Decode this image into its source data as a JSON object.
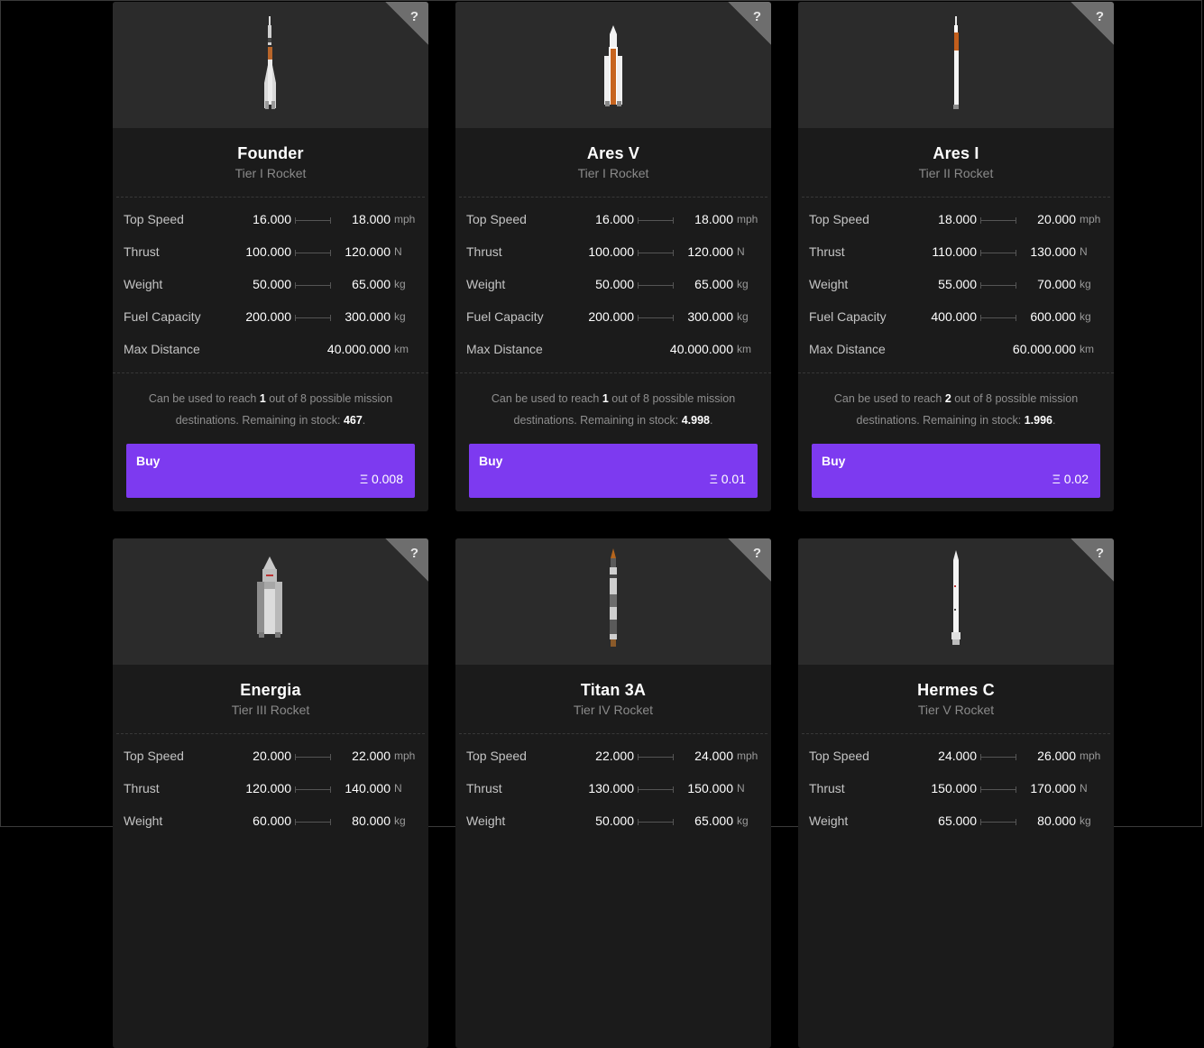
{
  "cards": [
    {
      "name": "Founder",
      "tier": "Tier I Rocket",
      "help": "?",
      "stats": {
        "top_speed": {
          "label": "Top Speed",
          "min": "16.000",
          "max": "18.000",
          "unit": "mph"
        },
        "thrust": {
          "label": "Thrust",
          "min": "100.000",
          "max": "120.000",
          "unit": "N"
        },
        "weight": {
          "label": "Weight",
          "min": "50.000",
          "max": "65.000",
          "unit": "kg"
        },
        "fuel": {
          "label": "Fuel Capacity",
          "min": "200.000",
          "max": "300.000",
          "unit": "kg"
        },
        "distance": {
          "label": "Max Distance",
          "value": "40.000.000",
          "unit": "km"
        }
      },
      "desc_pre": "Can be used to reach ",
      "reach": "1",
      "desc_mid": " out of 8 possible mission destinations. Remaining in stock: ",
      "stock": "467",
      "desc_end": ".",
      "buy_label": "Buy",
      "price": "Ξ 0.008"
    },
    {
      "name": "Ares V",
      "tier": "Tier I Rocket",
      "help": "?",
      "stats": {
        "top_speed": {
          "label": "Top Speed",
          "min": "16.000",
          "max": "18.000",
          "unit": "mph"
        },
        "thrust": {
          "label": "Thrust",
          "min": "100.000",
          "max": "120.000",
          "unit": "N"
        },
        "weight": {
          "label": "Weight",
          "min": "50.000",
          "max": "65.000",
          "unit": "kg"
        },
        "fuel": {
          "label": "Fuel Capacity",
          "min": "200.000",
          "max": "300.000",
          "unit": "kg"
        },
        "distance": {
          "label": "Max Distance",
          "value": "40.000.000",
          "unit": "km"
        }
      },
      "desc_pre": "Can be used to reach ",
      "reach": "1",
      "desc_mid": " out of 8 possible mission destinations. Remaining in stock: ",
      "stock": "4.998",
      "desc_end": ".",
      "buy_label": "Buy",
      "price": "Ξ 0.01"
    },
    {
      "name": "Ares I",
      "tier": "Tier II Rocket",
      "help": "?",
      "stats": {
        "top_speed": {
          "label": "Top Speed",
          "min": "18.000",
          "max": "20.000",
          "unit": "mph"
        },
        "thrust": {
          "label": "Thrust",
          "min": "110.000",
          "max": "130.000",
          "unit": "N"
        },
        "weight": {
          "label": "Weight",
          "min": "55.000",
          "max": "70.000",
          "unit": "kg"
        },
        "fuel": {
          "label": "Fuel Capacity",
          "min": "400.000",
          "max": "600.000",
          "unit": "kg"
        },
        "distance": {
          "label": "Max Distance",
          "value": "60.000.000",
          "unit": "km"
        }
      },
      "desc_pre": "Can be used to reach ",
      "reach": "2",
      "desc_mid": " out of 8 possible mission destinations. Remaining in stock: ",
      "stock": "1.996",
      "desc_end": ".",
      "buy_label": "Buy",
      "price": "Ξ 0.02"
    },
    {
      "name": "Energia",
      "tier": "Tier III Rocket",
      "help": "?",
      "stats": {
        "top_speed": {
          "label": "Top Speed",
          "min": "20.000",
          "max": "22.000",
          "unit": "mph"
        },
        "thrust": {
          "label": "Thrust",
          "min": "120.000",
          "max": "140.000",
          "unit": "N"
        },
        "weight": {
          "label": "Weight",
          "min": "60.000",
          "max": "80.000",
          "unit": "kg"
        }
      }
    },
    {
      "name": "Titan 3A",
      "tier": "Tier IV Rocket",
      "help": "?",
      "stats": {
        "top_speed": {
          "label": "Top Speed",
          "min": "22.000",
          "max": "24.000",
          "unit": "mph"
        },
        "thrust": {
          "label": "Thrust",
          "min": "130.000",
          "max": "150.000",
          "unit": "N"
        },
        "weight": {
          "label": "Weight",
          "min": "50.000",
          "max": "65.000",
          "unit": "kg"
        }
      }
    },
    {
      "name": "Hermes C",
      "tier": "Tier V Rocket",
      "help": "?",
      "stats": {
        "top_speed": {
          "label": "Top Speed",
          "min": "24.000",
          "max": "26.000",
          "unit": "mph"
        },
        "thrust": {
          "label": "Thrust",
          "min": "150.000",
          "max": "170.000",
          "unit": "N"
        },
        "weight": {
          "label": "Weight",
          "min": "65.000",
          "max": "80.000",
          "unit": "kg"
        }
      }
    }
  ],
  "colors": {
    "page_bg": "#000000",
    "card_bg": "#1b1b1b",
    "image_bg": "#2b2b2b",
    "buy_button": "#7d3af0",
    "corner_badge": "#6e6e6e"
  },
  "icons": [
    "help-corner-icon",
    "rocket-image"
  ]
}
